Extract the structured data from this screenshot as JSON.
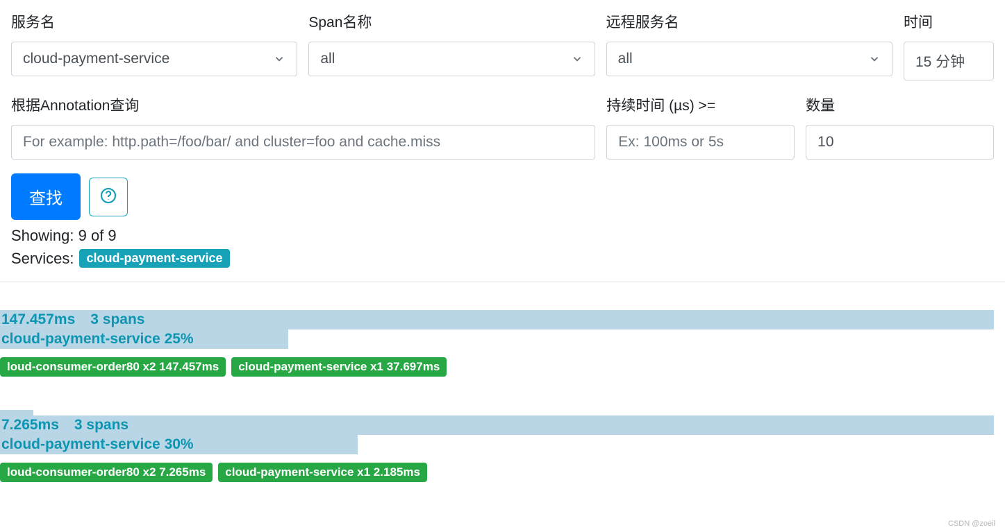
{
  "filters": {
    "serviceName": {
      "label": "服务名",
      "value": "cloud-payment-service"
    },
    "spanName": {
      "label": "Span名称",
      "value": "all"
    },
    "remoteService": {
      "label": "远程服务名",
      "value": "all"
    },
    "time": {
      "label": "时间",
      "value": "15 分钟"
    },
    "annotation": {
      "label": "根据Annotation查询",
      "placeholder": "For example: http.path=/foo/bar/ and cluster=foo and cache.miss",
      "value": ""
    },
    "duration": {
      "label": "持续时间 (µs) >=",
      "placeholder": "Ex: 100ms or 5s",
      "value": ""
    },
    "limit": {
      "label": "数量",
      "value": "10"
    }
  },
  "actions": {
    "findLabel": "查找"
  },
  "summary": {
    "showing": "Showing: 9 of 9",
    "servicesLabel": "Services:",
    "servicesBadge": "cloud-payment-service"
  },
  "results": [
    {
      "duration": "147.457ms",
      "spanCount": "3 spans",
      "serviceBarLabel": "cloud-payment-service 25%",
      "serviceBarPercent": 29,
      "topBarPercent": 100,
      "preTiny": false,
      "badges": [
        "loud-consumer-order80 x2 147.457ms",
        "cloud-payment-service x1 37.697ms"
      ]
    },
    {
      "duration": "7.265ms",
      "spanCount": "3 spans",
      "serviceBarLabel": "cloud-payment-service 30%",
      "serviceBarPercent": 36,
      "topBarPercent": 100,
      "preTiny": true,
      "badges": [
        "loud-consumer-order80 x2 7.265ms",
        "cloud-payment-service x1 2.185ms"
      ]
    }
  ],
  "watermark": "CSDN @zoeil"
}
